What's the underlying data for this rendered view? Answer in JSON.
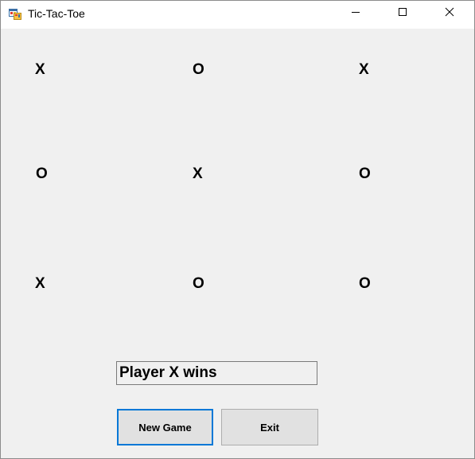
{
  "window": {
    "title": "Tic-Tac-Toe",
    "icon": "winforms-app-icon",
    "controls": {
      "minimize": "minimize-icon",
      "maximize": "maximize-icon",
      "close": "close-icon"
    }
  },
  "board": {
    "cells": [
      [
        "X",
        "O",
        "X"
      ],
      [
        "O",
        "X",
        "O"
      ],
      [
        "X",
        "O",
        "O"
      ]
    ]
  },
  "status": {
    "text": "Player X wins"
  },
  "buttons": {
    "new_game": "New Game",
    "exit": "Exit"
  },
  "colors": {
    "focus_border": "#0078d7",
    "form_background": "#f0f0f0"
  }
}
